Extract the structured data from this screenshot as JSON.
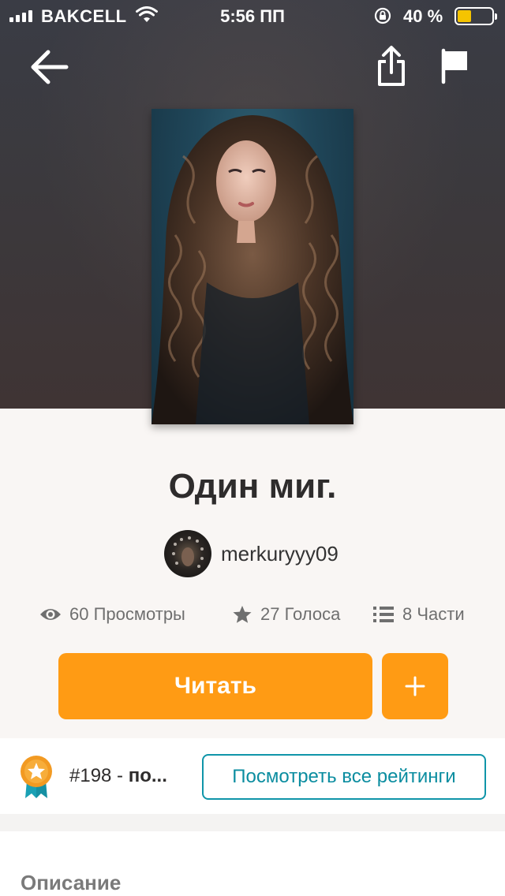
{
  "status_bar": {
    "carrier": "BAKCELL",
    "time": "5:56 ПП",
    "battery": "40 %",
    "battery_level": 0.4
  },
  "header": {
    "back_icon": "back-arrow-icon",
    "share_icon": "share-icon",
    "flag_icon": "flag-icon"
  },
  "story": {
    "title": "Один миг.",
    "author": "merkuryyy09"
  },
  "stats": {
    "views": "60 Просмотры",
    "votes": "27 Голоса",
    "parts": "8 Части"
  },
  "actions": {
    "read_label": "Читать",
    "add_label": "+"
  },
  "ranking": {
    "rank": "#198",
    "separator": " - ",
    "category": "по...",
    "view_all_label": "Посмотреть все рейтинги"
  },
  "description": {
    "heading": "Описание"
  },
  "colors": {
    "accent": "#ff9b14",
    "link": "#0f95a9",
    "battery": "#f5c400"
  }
}
